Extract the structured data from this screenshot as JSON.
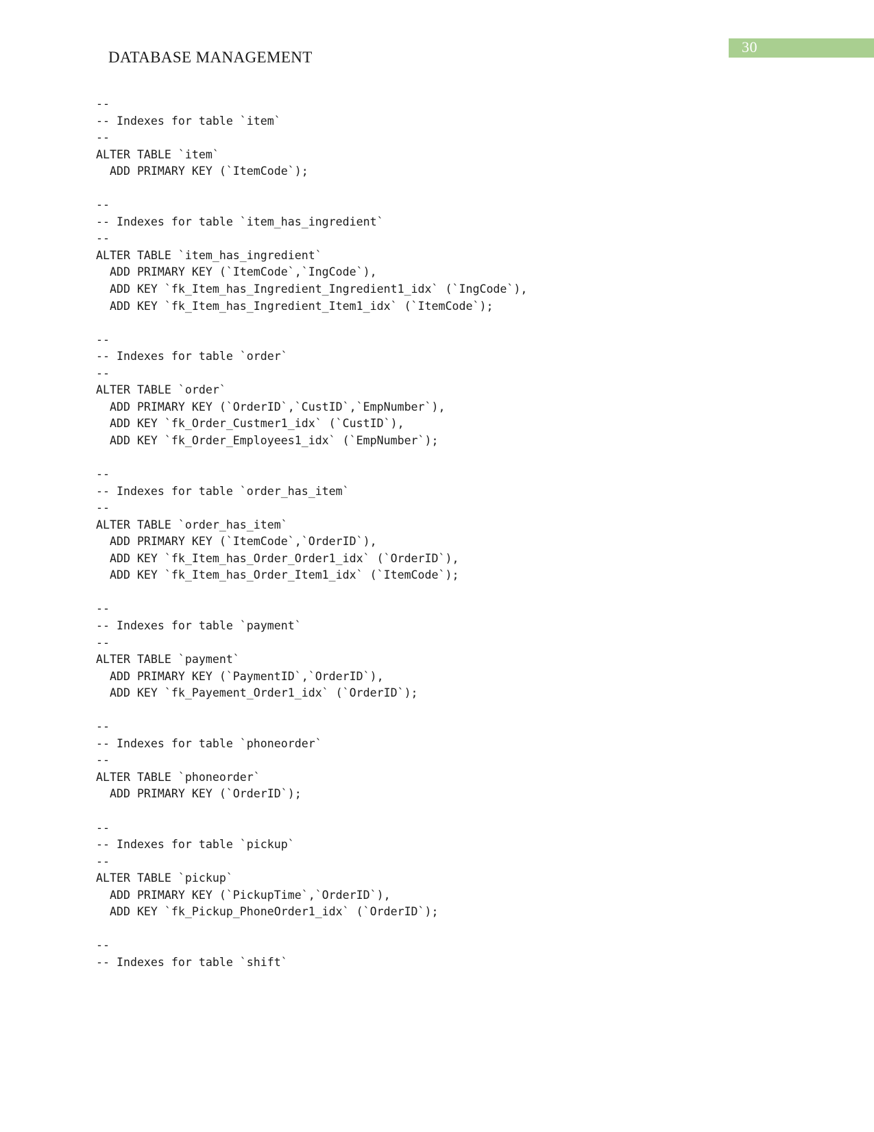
{
  "header": {
    "title": "DATABASE MANAGEMENT",
    "page_number": "30",
    "banner_color": "#a9cf90",
    "page_number_color": "#ffffff"
  },
  "document": {
    "type": "sql-dump",
    "text_color": "#1b1b1b",
    "background_color": "#ffffff"
  },
  "code": {
    "lines": [
      "--",
      "-- Indexes for table `item`",
      "--",
      "ALTER TABLE `item`",
      "  ADD PRIMARY KEY (`ItemCode`);",
      "",
      "--",
      "-- Indexes for table `item_has_ingredient`",
      "--",
      "ALTER TABLE `item_has_ingredient`",
      "  ADD PRIMARY KEY (`ItemCode`,`IngCode`),",
      "  ADD KEY `fk_Item_has_Ingredient_Ingredient1_idx` (`IngCode`),",
      "  ADD KEY `fk_Item_has_Ingredient_Item1_idx` (`ItemCode`);",
      "",
      "--",
      "-- Indexes for table `order`",
      "--",
      "ALTER TABLE `order`",
      "  ADD PRIMARY KEY (`OrderID`,`CustID`,`EmpNumber`),",
      "  ADD KEY `fk_Order_Custmer1_idx` (`CustID`),",
      "  ADD KEY `fk_Order_Employees1_idx` (`EmpNumber`);",
      "",
      "--",
      "-- Indexes for table `order_has_item`",
      "--",
      "ALTER TABLE `order_has_item`",
      "  ADD PRIMARY KEY (`ItemCode`,`OrderID`),",
      "  ADD KEY `fk_Item_has_Order_Order1_idx` (`OrderID`),",
      "  ADD KEY `fk_Item_has_Order_Item1_idx` (`ItemCode`);",
      "",
      "--",
      "-- Indexes for table `payment`",
      "--",
      "ALTER TABLE `payment`",
      "  ADD PRIMARY KEY (`PaymentID`,`OrderID`),",
      "  ADD KEY `fk_Payement_Order1_idx` (`OrderID`);",
      "",
      "--",
      "-- Indexes for table `phoneorder`",
      "--",
      "ALTER TABLE `phoneorder`",
      "  ADD PRIMARY KEY (`OrderID`);",
      "",
      "--",
      "-- Indexes for table `pickup`",
      "--",
      "ALTER TABLE `pickup`",
      "  ADD PRIMARY KEY (`PickupTime`,`OrderID`),",
      "  ADD KEY `fk_Pickup_PhoneOrder1_idx` (`OrderID`);",
      "",
      "--",
      "-- Indexes for table `shift`"
    ]
  }
}
